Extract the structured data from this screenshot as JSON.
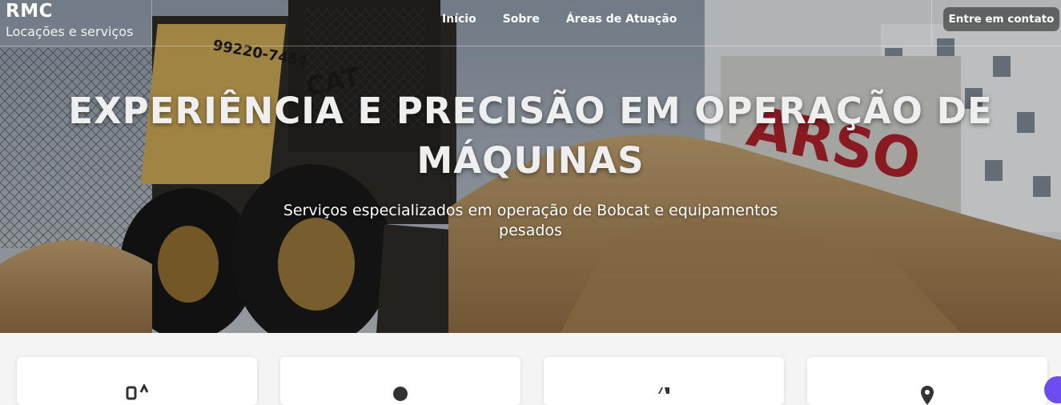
{
  "brand": {
    "name": "RMC",
    "tagline": "Locações e serviços"
  },
  "nav": {
    "items": [
      {
        "label": "Início"
      },
      {
        "label": "Sobre"
      },
      {
        "label": "Áreas de Atuação"
      }
    ],
    "cta_label": "Entre em contato"
  },
  "hero": {
    "title": "EXPERIÊNCIA E PRECISÃO EM OPERAÇÃO DE MÁQUINAS",
    "subtitle": "Serviços especializados em operação de Bobcat e equipamentos pesados"
  },
  "cards": [
    {
      "icon": "equipment-icon"
    },
    {
      "icon": "person-icon"
    },
    {
      "icon": "tools-icon"
    },
    {
      "icon": "location-icon"
    }
  ],
  "colors": {
    "accent": "#6d4cf0",
    "hero_text": "#efefef",
    "card_bg": "#ffffff",
    "page_bg": "#f4f4f4"
  }
}
